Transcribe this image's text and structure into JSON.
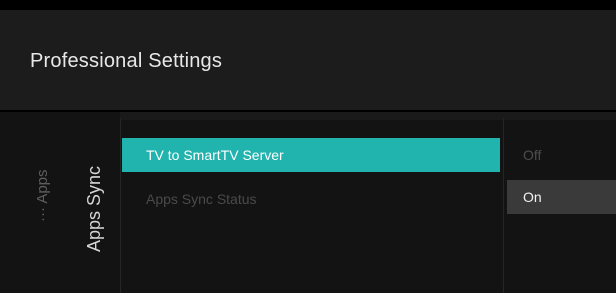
{
  "header": {
    "title": "Professional Settings"
  },
  "breadcrumb": {
    "parent": "··· Apps",
    "current": "Apps Sync"
  },
  "menu": {
    "items": [
      {
        "label": "TV to SmartTV Server",
        "state": "selected"
      },
      {
        "label": "Apps Sync Status",
        "state": "disabled"
      }
    ]
  },
  "options": {
    "items": [
      {
        "label": "Off",
        "state": "inactive"
      },
      {
        "label": "On",
        "state": "selected"
      }
    ]
  },
  "colors": {
    "accent": "#21b3ad",
    "background": "#000000",
    "header_bg": "#1c1c1c",
    "menu_bg": "#131313"
  }
}
